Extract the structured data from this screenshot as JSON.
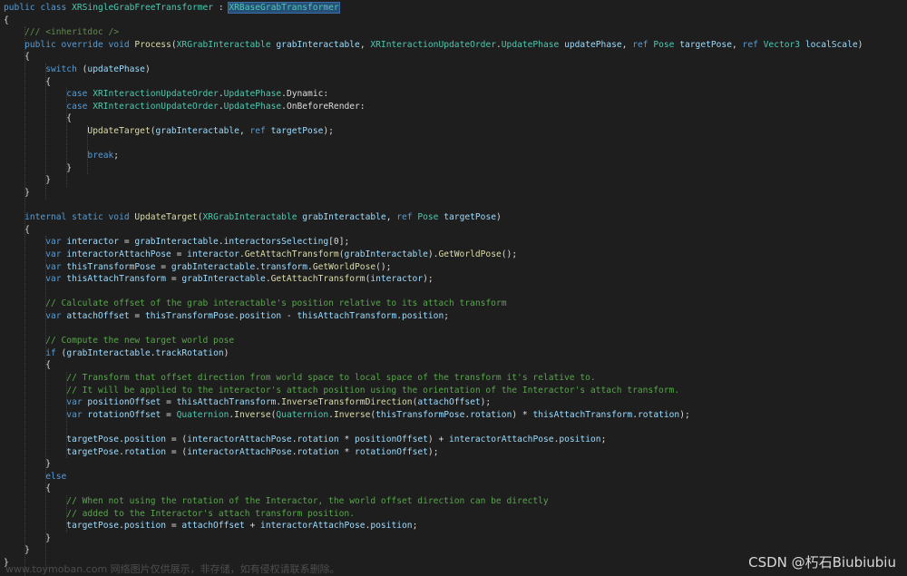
{
  "code": {
    "lines": [
      [
        [
          "kw",
          "public "
        ],
        [
          "kw",
          "class "
        ],
        [
          "ty",
          "XRSingleGrabFreeTransformer"
        ],
        [
          "tx",
          " : "
        ],
        [
          "hl",
          "XRBaseGrabTransformer"
        ]
      ],
      [
        [
          "tx",
          "{"
        ]
      ],
      [
        [
          "doc",
          "    /// <inheritdoc />"
        ]
      ],
      [
        [
          "kw",
          "    public "
        ],
        [
          "kw",
          "override "
        ],
        [
          "kw",
          "void "
        ],
        [
          "fn",
          "Process"
        ],
        [
          "tx",
          "("
        ],
        [
          "ty",
          "XRGrabInteractable"
        ],
        [
          "tx",
          " "
        ],
        [
          "pr",
          "grabInteractable"
        ],
        [
          "tx",
          ", "
        ],
        [
          "ty",
          "XRInteractionUpdateOrder"
        ],
        [
          "tx",
          "."
        ],
        [
          "ty",
          "UpdatePhase"
        ],
        [
          "tx",
          " "
        ],
        [
          "pr",
          "updatePhase"
        ],
        [
          "tx",
          ", "
        ],
        [
          "kw",
          "ref "
        ],
        [
          "ty",
          "Pose"
        ],
        [
          "tx",
          " "
        ],
        [
          "pr",
          "targetPose"
        ],
        [
          "tx",
          ", "
        ],
        [
          "kw",
          "ref "
        ],
        [
          "ty",
          "Vector3"
        ],
        [
          "tx",
          " "
        ],
        [
          "pr",
          "localScale"
        ],
        [
          "tx",
          ")"
        ]
      ],
      [
        [
          "tx",
          "    {"
        ]
      ],
      [
        [
          "kw",
          "        switch "
        ],
        [
          "tx",
          "("
        ],
        [
          "pr",
          "updatePhase"
        ],
        [
          "tx",
          ")"
        ]
      ],
      [
        [
          "tx",
          "        {"
        ]
      ],
      [
        [
          "kw",
          "            case "
        ],
        [
          "ty",
          "XRInteractionUpdateOrder"
        ],
        [
          "tx",
          "."
        ],
        [
          "ty",
          "UpdatePhase"
        ],
        [
          "tx",
          "."
        ],
        [
          "tx",
          "Dynamic:"
        ]
      ],
      [
        [
          "kw",
          "            case "
        ],
        [
          "ty",
          "XRInteractionUpdateOrder"
        ],
        [
          "tx",
          "."
        ],
        [
          "ty",
          "UpdatePhase"
        ],
        [
          "tx",
          "."
        ],
        [
          "tx",
          "OnBeforeRender:"
        ]
      ],
      [
        [
          "tx",
          "            {"
        ]
      ],
      [
        [
          "fn",
          "                UpdateTarget"
        ],
        [
          "tx",
          "("
        ],
        [
          "pr",
          "grabInteractable"
        ],
        [
          "tx",
          ", "
        ],
        [
          "kw",
          "ref "
        ],
        [
          "pr",
          "targetPose"
        ],
        [
          "tx",
          ");"
        ]
      ],
      [
        [
          "tx",
          ""
        ]
      ],
      [
        [
          "kw",
          "                break"
        ],
        [
          "tx",
          ";"
        ]
      ],
      [
        [
          "tx",
          "            }"
        ]
      ],
      [
        [
          "tx",
          "        }"
        ]
      ],
      [
        [
          "tx",
          "    }"
        ]
      ],
      [
        [
          "tx",
          ""
        ]
      ],
      [
        [
          "kw",
          "    internal "
        ],
        [
          "kw",
          "static "
        ],
        [
          "kw",
          "void "
        ],
        [
          "fn",
          "UpdateTarget"
        ],
        [
          "tx",
          "("
        ],
        [
          "ty",
          "XRGrabInteractable"
        ],
        [
          "tx",
          " "
        ],
        [
          "pr",
          "grabInteractable"
        ],
        [
          "tx",
          ", "
        ],
        [
          "kw",
          "ref "
        ],
        [
          "ty",
          "Pose"
        ],
        [
          "tx",
          " "
        ],
        [
          "pr",
          "targetPose"
        ],
        [
          "tx",
          ")"
        ]
      ],
      [
        [
          "tx",
          "    {"
        ]
      ],
      [
        [
          "kw",
          "        var "
        ],
        [
          "pr",
          "interactor"
        ],
        [
          "tx",
          " = "
        ],
        [
          "pr",
          "grabInteractable"
        ],
        [
          "tx",
          "."
        ],
        [
          "pr",
          "interactorsSelecting"
        ],
        [
          "tx",
          "[0];"
        ]
      ],
      [
        [
          "kw",
          "        var "
        ],
        [
          "pr",
          "interactorAttachPose"
        ],
        [
          "tx",
          " = "
        ],
        [
          "pr",
          "interactor"
        ],
        [
          "tx",
          "."
        ],
        [
          "fn",
          "GetAttachTransform"
        ],
        [
          "tx",
          "("
        ],
        [
          "pr",
          "grabInteractable"
        ],
        [
          "tx",
          ")."
        ],
        [
          "fn",
          "GetWorldPose"
        ],
        [
          "tx",
          "();"
        ]
      ],
      [
        [
          "kw",
          "        var "
        ],
        [
          "pr",
          "thisTransformPose"
        ],
        [
          "tx",
          " = "
        ],
        [
          "pr",
          "grabInteractable"
        ],
        [
          "tx",
          "."
        ],
        [
          "pr",
          "transform"
        ],
        [
          "tx",
          "."
        ],
        [
          "fn",
          "GetWorldPose"
        ],
        [
          "tx",
          "();"
        ]
      ],
      [
        [
          "kw",
          "        var "
        ],
        [
          "pr",
          "thisAttachTransform"
        ],
        [
          "tx",
          " = "
        ],
        [
          "pr",
          "grabInteractable"
        ],
        [
          "tx",
          "."
        ],
        [
          "fn",
          "GetAttachTransform"
        ],
        [
          "tx",
          "("
        ],
        [
          "pr",
          "interactor"
        ],
        [
          "tx",
          ");"
        ]
      ],
      [
        [
          "tx",
          ""
        ]
      ],
      [
        [
          "cm",
          "        // Calculate offset of the grab interactable's position relative to its attach transform"
        ]
      ],
      [
        [
          "kw",
          "        var "
        ],
        [
          "pr",
          "attachOffset"
        ],
        [
          "tx",
          " = "
        ],
        [
          "pr",
          "thisTransformPose"
        ],
        [
          "tx",
          "."
        ],
        [
          "pr",
          "position"
        ],
        [
          "tx",
          " - "
        ],
        [
          "pr",
          "thisAttachTransform"
        ],
        [
          "tx",
          "."
        ],
        [
          "pr",
          "position"
        ],
        [
          "tx",
          ";"
        ]
      ],
      [
        [
          "tx",
          ""
        ]
      ],
      [
        [
          "cm",
          "        // Compute the new target world pose"
        ]
      ],
      [
        [
          "kw",
          "        if "
        ],
        [
          "tx",
          "("
        ],
        [
          "pr",
          "grabInteractable"
        ],
        [
          "tx",
          "."
        ],
        [
          "pr",
          "trackRotation"
        ],
        [
          "tx",
          ")"
        ]
      ],
      [
        [
          "tx",
          "        {"
        ]
      ],
      [
        [
          "cm",
          "            // Transform that offset direction from world space to local space of the transform it's relative to."
        ]
      ],
      [
        [
          "cm",
          "            // It will be applied to the interactor's attach position using the orientation of the Interactor's attach transform."
        ]
      ],
      [
        [
          "kw",
          "            var "
        ],
        [
          "pr",
          "positionOffset"
        ],
        [
          "tx",
          " = "
        ],
        [
          "pr",
          "thisAttachTransform"
        ],
        [
          "tx",
          "."
        ],
        [
          "fn",
          "InverseTransformDirection"
        ],
        [
          "tx",
          "("
        ],
        [
          "pr",
          "attachOffset"
        ],
        [
          "tx",
          ");"
        ]
      ],
      [
        [
          "kw",
          "            var "
        ],
        [
          "pr",
          "rotationOffset"
        ],
        [
          "tx",
          " = "
        ],
        [
          "ty",
          "Quaternion"
        ],
        [
          "tx",
          "."
        ],
        [
          "fn",
          "Inverse"
        ],
        [
          "tx",
          "("
        ],
        [
          "ty",
          "Quaternion"
        ],
        [
          "tx",
          "."
        ],
        [
          "fn",
          "Inverse"
        ],
        [
          "tx",
          "("
        ],
        [
          "pr",
          "thisTransformPose"
        ],
        [
          "tx",
          "."
        ],
        [
          "pr",
          "rotation"
        ],
        [
          "tx",
          ") * "
        ],
        [
          "pr",
          "thisAttachTransform"
        ],
        [
          "tx",
          "."
        ],
        [
          "pr",
          "rotation"
        ],
        [
          "tx",
          ");"
        ]
      ],
      [
        [
          "tx",
          ""
        ]
      ],
      [
        [
          "pr",
          "            targetPose"
        ],
        [
          "tx",
          "."
        ],
        [
          "pr",
          "position"
        ],
        [
          "tx",
          " = ("
        ],
        [
          "pr",
          "interactorAttachPose"
        ],
        [
          "tx",
          "."
        ],
        [
          "pr",
          "rotation"
        ],
        [
          "tx",
          " * "
        ],
        [
          "pr",
          "positionOffset"
        ],
        [
          "tx",
          ") + "
        ],
        [
          "pr",
          "interactorAttachPose"
        ],
        [
          "tx",
          "."
        ],
        [
          "pr",
          "position"
        ],
        [
          "tx",
          ";"
        ]
      ],
      [
        [
          "pr",
          "            targetPose"
        ],
        [
          "tx",
          "."
        ],
        [
          "pr",
          "rotation"
        ],
        [
          "tx",
          " = ("
        ],
        [
          "pr",
          "interactorAttachPose"
        ],
        [
          "tx",
          "."
        ],
        [
          "pr",
          "rotation"
        ],
        [
          "tx",
          " * "
        ],
        [
          "pr",
          "rotationOffset"
        ],
        [
          "tx",
          ");"
        ]
      ],
      [
        [
          "tx",
          "        }"
        ]
      ],
      [
        [
          "kw",
          "        else"
        ]
      ],
      [
        [
          "tx",
          "        {"
        ]
      ],
      [
        [
          "cm",
          "            // When not using the rotation of the Interactor, the world offset direction can be directly"
        ]
      ],
      [
        [
          "cm",
          "            // added to the Interactor's attach transform position."
        ]
      ],
      [
        [
          "pr",
          "            targetPose"
        ],
        [
          "tx",
          "."
        ],
        [
          "pr",
          "position"
        ],
        [
          "tx",
          " = "
        ],
        [
          "pr",
          "attachOffset"
        ],
        [
          "tx",
          " + "
        ],
        [
          "pr",
          "interactorAttachPose"
        ],
        [
          "tx",
          "."
        ],
        [
          "pr",
          "position"
        ],
        [
          "tx",
          ";"
        ]
      ],
      [
        [
          "tx",
          "        }"
        ]
      ],
      [
        [
          "tx",
          "    }"
        ]
      ],
      [
        [
          "tx",
          "}"
        ]
      ]
    ]
  },
  "watermark": {
    "url": "www.toymoban.com 网络图片仅供展示，非存储，如有侵权请联系删除。",
    "author": "CSDN @朽石Biubiubiu"
  },
  "colors": {
    "background": "#1e1e1e",
    "keyword": "#569cd6",
    "type": "#4ec9b0",
    "method": "#dcdcaa",
    "identifier": "#9cdcfe",
    "comment": "#57a64a"
  }
}
